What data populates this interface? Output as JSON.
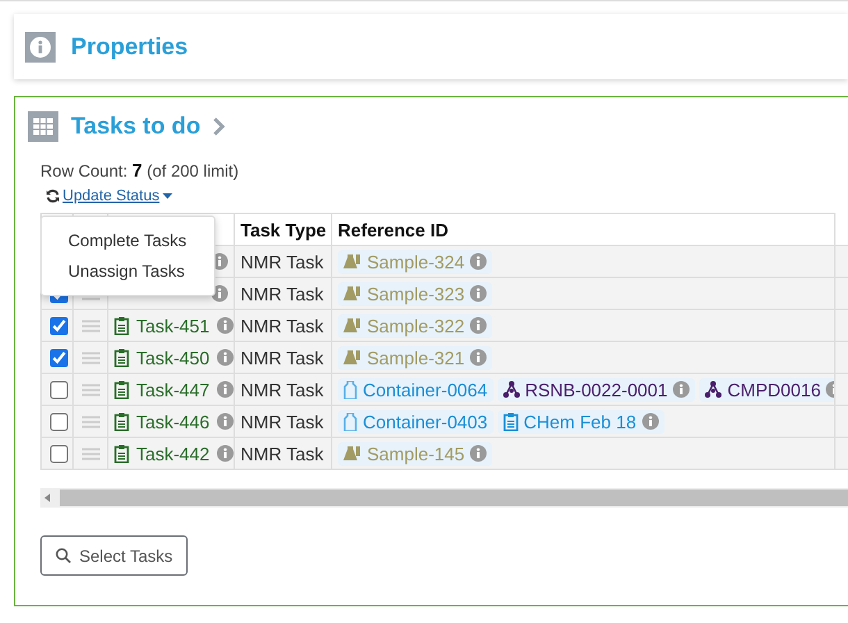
{
  "properties_panel": {
    "title": "Properties"
  },
  "tasks_panel": {
    "title": "Tasks to do",
    "row_count_label": "Row Count:",
    "row_count": "7",
    "row_limit": "(of 200 limit)",
    "update_status": {
      "label": "Update Status",
      "expanded": true,
      "menu": [
        "Complete Tasks",
        "Unassign Tasks"
      ]
    },
    "table": {
      "columns": [
        "Task Type",
        "Reference ID"
      ],
      "rows": [
        {
          "task_type": "NMR Task",
          "references": [
            {
              "kind": "sample",
              "label": "Sample-324",
              "info": true
            }
          ]
        },
        {
          "checked": true,
          "task_type": "NMR Task",
          "references": [
            {
              "kind": "sample",
              "label": "Sample-323",
              "info": true
            }
          ]
        },
        {
          "checked": true,
          "task": "Task-451",
          "task_type": "NMR Task",
          "references": [
            {
              "kind": "sample",
              "label": "Sample-322",
              "info": true
            }
          ]
        },
        {
          "checked": true,
          "task": "Task-450",
          "task_type": "NMR Task",
          "references": [
            {
              "kind": "sample",
              "label": "Sample-321",
              "info": true
            }
          ]
        },
        {
          "checked": false,
          "task": "Task-447",
          "task_type": "NMR Task",
          "references": [
            {
              "kind": "container",
              "label": "Container-0064",
              "info": false
            },
            {
              "kind": "compound",
              "label": "RSNB-0022-0001",
              "info": true
            },
            {
              "kind": "compound",
              "label": "CMPD0016",
              "info": true
            }
          ]
        },
        {
          "checked": false,
          "task": "Task-446",
          "task_type": "NMR Task",
          "references": [
            {
              "kind": "container",
              "label": "Container-0403",
              "info": false
            },
            {
              "kind": "notebook",
              "label": "CHem Feb 18",
              "info": true
            }
          ]
        },
        {
          "checked": false,
          "task": "Task-442",
          "task_type": "NMR Task",
          "references": [
            {
              "kind": "sample",
              "label": "Sample-145",
              "info": true
            }
          ]
        }
      ]
    },
    "select_button": "Select Tasks"
  }
}
